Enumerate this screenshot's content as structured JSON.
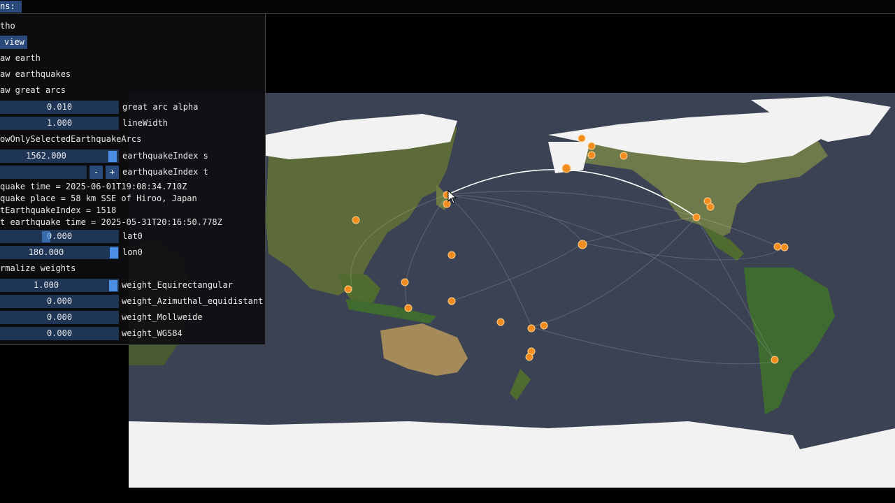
{
  "menu": {
    "title": "ns:"
  },
  "panel": {
    "projection_label": "tho",
    "view_button": "view",
    "draw_earth": "aw earth",
    "draw_earthquakes": "aw earthquakes",
    "draw_great_arcs": "aw great arcs",
    "great_arc_alpha": {
      "value": "0.010",
      "label": "great arc alpha"
    },
    "line_width": {
      "value": "1.000",
      "label": "lineWidth"
    },
    "show_only_selected": "owOnlySelectedEarthquakeArcs",
    "earthquake_index_s": {
      "value": "1562.000",
      "label": "earthquakeIndex s"
    },
    "earthquake_index_t": {
      "label": "earthquakeIndex t",
      "minus": "-",
      "plus": "+"
    },
    "info_time": "quake time = 2025-06-01T19:08:34.710Z",
    "info_place": "quake place = 58 km SSE of Hiroo, Japan",
    "info_index": "tEarthquakeIndex = 1518",
    "info_t_time": "t earthquake time = 2025-05-31T20:16:50.778Z",
    "lat0": {
      "value": "0.000",
      "label": "lat0"
    },
    "lon0": {
      "value": "180.000",
      "label": "lon0"
    },
    "normalize_weights": "rmalize weights",
    "weights": [
      {
        "value": "1.000",
        "label": "weight_Equirectangular"
      },
      {
        "value": "0.000",
        "label": "weight_Azimuthal_equidistant"
      },
      {
        "value": "0.000",
        "label": "weight_Mollweide"
      },
      {
        "value": "0.000",
        "label": "weight_WGS84"
      }
    ]
  },
  "colors": {
    "accent": "#294a7a",
    "slider_bg": "#1e3556",
    "slider_knob": "#4a8ee6",
    "quake": "#f28c1e"
  }
}
